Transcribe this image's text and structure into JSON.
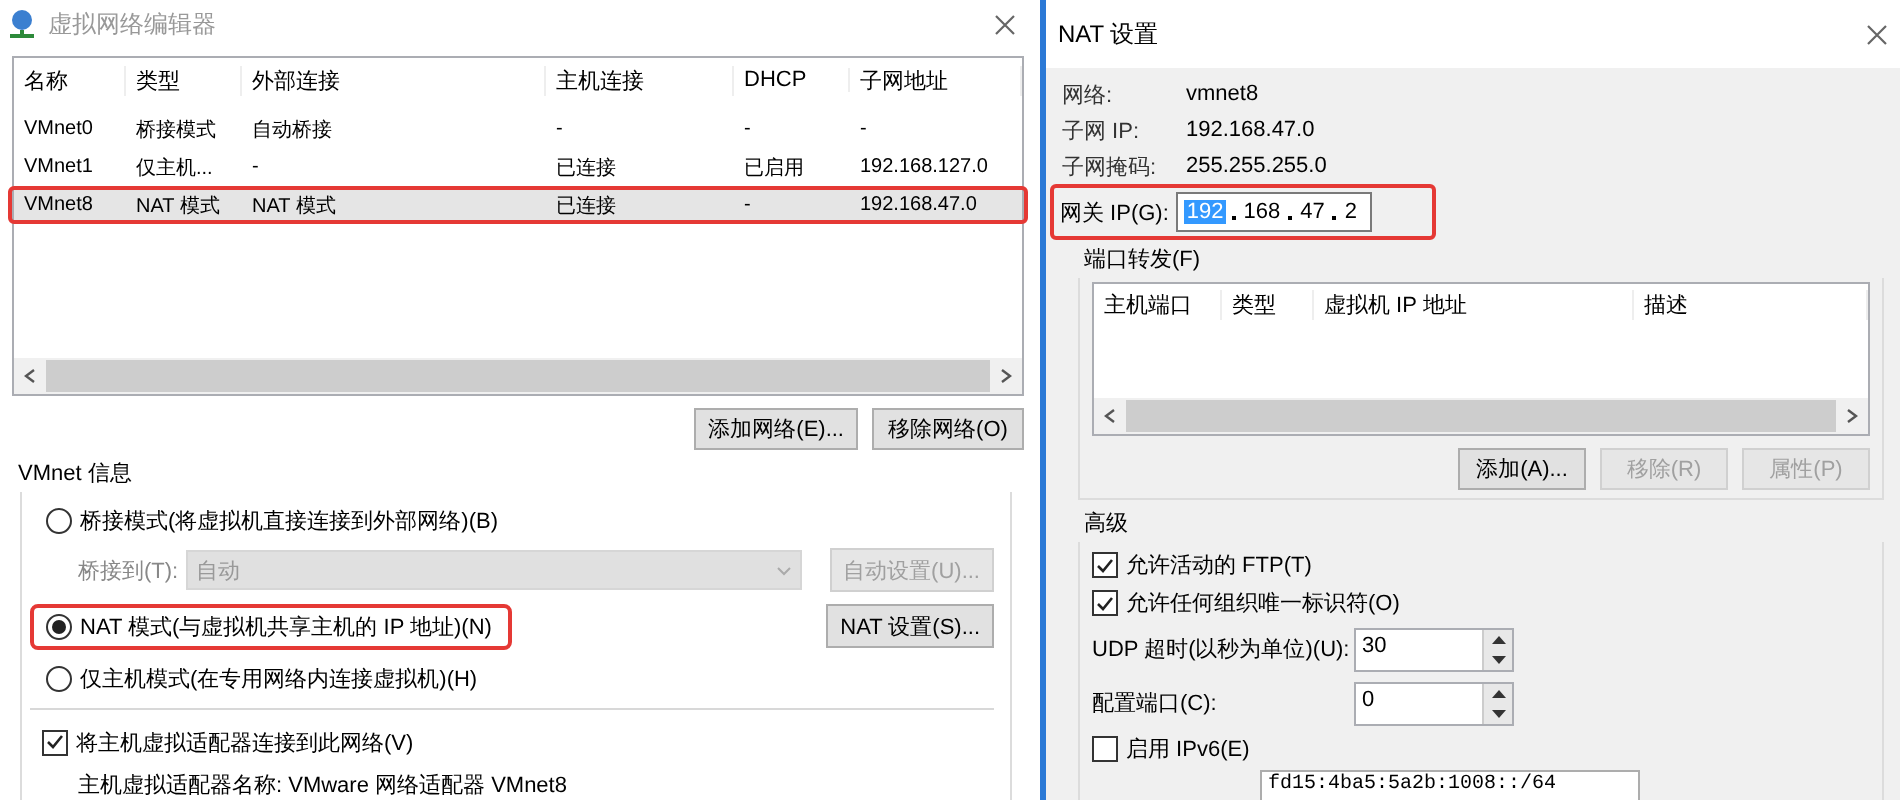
{
  "editor": {
    "title": "虚拟网络编辑器",
    "columns": [
      "名称",
      "类型",
      "外部连接",
      "主机连接",
      "DHCP",
      "子网地址"
    ],
    "rows": [
      {
        "cells": [
          "VMnet0",
          "桥接模式",
          "自动桥接",
          "-",
          "-",
          "-"
        ],
        "selected": false,
        "highlighted": false
      },
      {
        "cells": [
          "VMnet1",
          "仅主机...",
          "-",
          "已连接",
          "已启用",
          "192.168.127.0"
        ],
        "selected": false,
        "highlighted": false
      },
      {
        "cells": [
          "VMnet8",
          "NAT 模式",
          "NAT 模式",
          "已连接",
          "-",
          "192.168.47.0"
        ],
        "selected": true,
        "highlighted": true
      }
    ],
    "buttons": [
      {
        "label": "添加网络(E)...",
        "disabled": false
      },
      {
        "label": "移除网络(O)",
        "disabled": false
      }
    ],
    "info": {
      "title": "VMnet 信息",
      "modes": [
        {
          "label": "桥接模式(将虚拟机直接连接到外部网络)(B)",
          "selected": false,
          "highlighted": false
        },
        {
          "label": "NAT 模式(与虚拟机共享主机的 IP 地址)(N)",
          "selected": true,
          "highlighted": true
        },
        {
          "label": "仅主机模式(在专用网络内连接虚拟机)(H)",
          "selected": false,
          "highlighted": false
        }
      ],
      "bridge_to": {
        "label": "桥接到(T):",
        "value": "自动",
        "disabled": true
      },
      "auto_button": {
        "label": "自动设置(U)...",
        "disabled": true
      },
      "nat_button": {
        "label": "NAT 设置(S)...",
        "disabled": false
      },
      "connect_adapter": {
        "label": "将主机虚拟适配器连接到此网络(V)",
        "checked": true
      },
      "adapter_name": "主机虚拟适配器名称: VMware 网络适配器 VMnet8"
    }
  },
  "nat": {
    "title": "NAT 设置",
    "info": [
      {
        "label": "网络:",
        "value": "vmnet8"
      },
      {
        "label": "子网 IP:",
        "value": "192.168.47.0"
      },
      {
        "label": "子网掩码:",
        "value": "255.255.255.0"
      }
    ],
    "gateway": {
      "label": "网关 IP(G):",
      "highlighted": true,
      "octets": [
        {
          "text": "192",
          "selected": true
        },
        {
          "text": "168",
          "selected": false
        },
        {
          "text": "47",
          "selected": false
        },
        {
          "text": "2",
          "selected": false
        }
      ]
    },
    "port_forwarding": {
      "title": "端口转发(F)",
      "columns": [
        "主机端口",
        "类型",
        "虚拟机 IP 地址",
        "描述"
      ],
      "buttons": [
        {
          "label": "添加(A)...",
          "disabled": false
        },
        {
          "label": "移除(R)",
          "disabled": true
        },
        {
          "label": "属性(P)",
          "disabled": true
        }
      ]
    },
    "advanced": {
      "title": "高级",
      "options": [
        {
          "kind": "checkbox",
          "label": "允许活动的 FTP(T)",
          "checked": true
        },
        {
          "kind": "checkbox",
          "label": "允许任何组织唯一标识符(O)",
          "checked": true
        },
        {
          "kind": "spinner",
          "label": "UDP 超时(以秒为单位)(U):",
          "value": "30"
        },
        {
          "kind": "spinner",
          "label": "配置端口(C):",
          "value": "0"
        },
        {
          "kind": "checkbox",
          "label": "启用 IPv6(E)",
          "checked": false
        },
        {
          "kind": "field",
          "value": "fd15:4ba5:5a2b:1008::/64"
        }
      ]
    }
  }
}
